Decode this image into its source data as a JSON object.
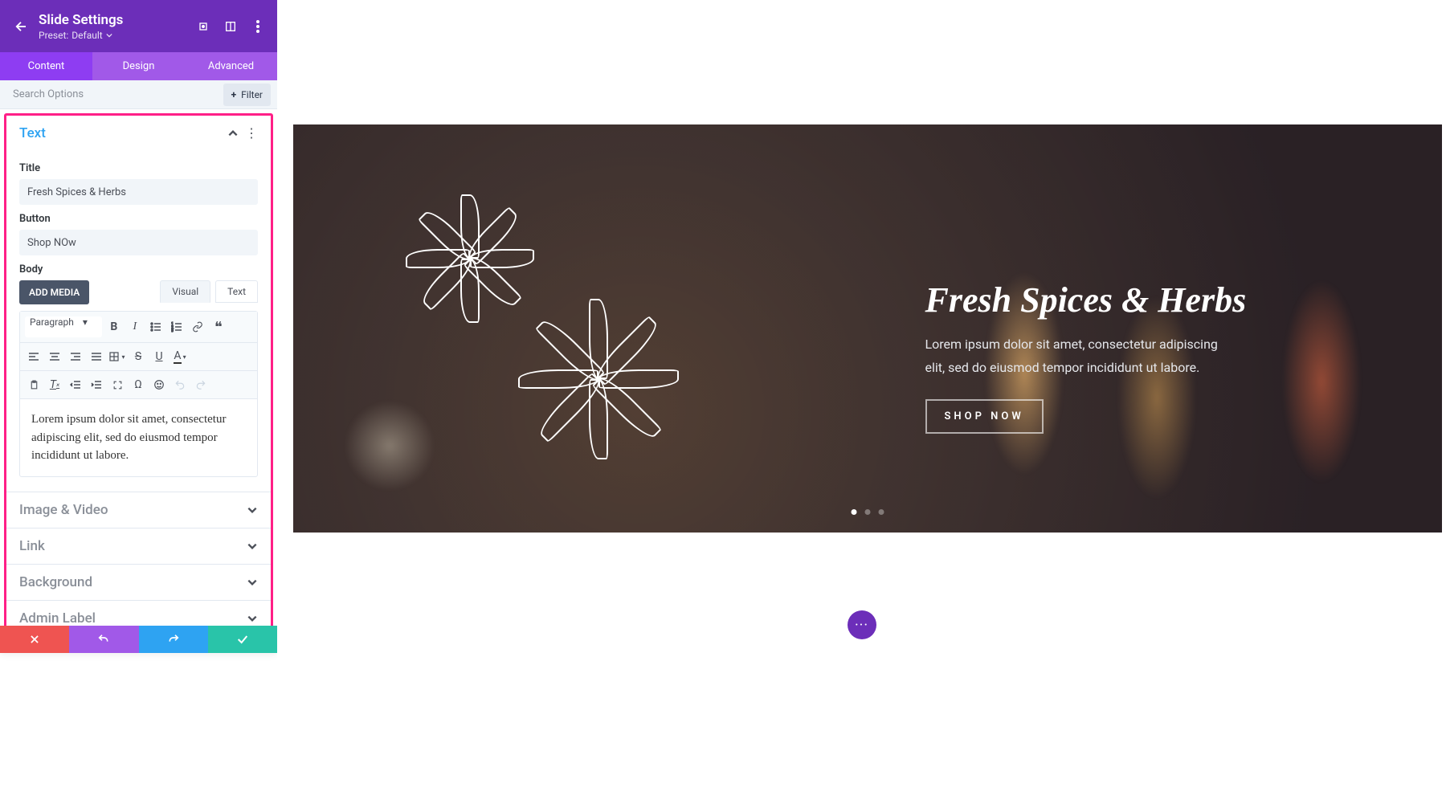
{
  "panel": {
    "title": "Slide Settings",
    "preset_label": "Preset:",
    "preset_value": "Default",
    "tabs": [
      "Content",
      "Design",
      "Advanced"
    ],
    "active_tab": 0,
    "search_placeholder": "Search Options",
    "filter_label": "Filter"
  },
  "sections": {
    "text": {
      "title": "Text",
      "fields": {
        "title_label": "Title",
        "title_value": "Fresh Spices & Herbs",
        "button_label": "Button",
        "button_value": "Shop NOw",
        "body_label": "Body",
        "add_media_label": "ADD MEDIA",
        "mode_visual": "Visual",
        "mode_text": "Text",
        "paragraph_label": "Paragraph",
        "body_content": "Lorem ipsum dolor sit amet, consectetur adipiscing elit, sed do eiusmod tempor incididunt ut labore."
      }
    },
    "image_video": "Image & Video",
    "link": "Link",
    "background": "Background",
    "admin_label": "Admin Label"
  },
  "slide": {
    "title": "Fresh Spices & Herbs",
    "body": "Lorem ipsum dolor sit amet, consectetur adipiscing elit, sed do eiusmod tempor incididunt ut labore.",
    "button": "SHOP NOW",
    "dot_count": 3,
    "active_dot": 0
  },
  "toolbar": {
    "icons_row1": [
      "bold-icon",
      "italic-icon",
      "bullet-list-icon",
      "number-list-icon",
      "link-icon",
      "quote-icon"
    ],
    "icons_row2": [
      "align-left-icon",
      "align-center-icon",
      "align-right-icon",
      "align-justify-icon",
      "table-icon",
      "strike-icon",
      "underline-icon",
      "text-color-icon"
    ],
    "icons_row3": [
      "paste-icon",
      "clear-format-icon",
      "outdent-icon",
      "indent-icon",
      "fullscreen-icon",
      "special-char-icon",
      "emoji-icon",
      "undo-icon",
      "redo-icon"
    ]
  }
}
